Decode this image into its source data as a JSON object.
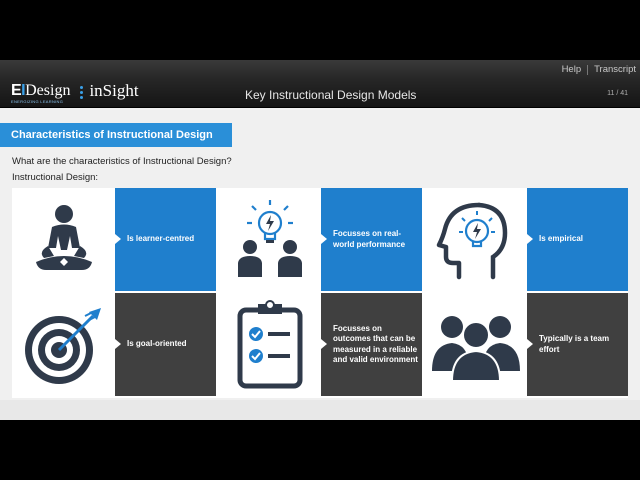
{
  "player": {
    "links": [
      "Help",
      "Transcript"
    ],
    "logo": {
      "ei_e": "E",
      "ei_i": "I",
      "design": "Design",
      "tagline": "ENERGIZING LEARNING",
      "product": "inSight"
    },
    "title": "Key Instructional Design Models",
    "slide_counter": "11 / 41"
  },
  "slide": {
    "banner": "Characteristics of Instructional Design",
    "question": "What are the characteristics of Instructional Design?",
    "intro": "Instructional Design:",
    "cards": [
      {
        "icon": "meditating-person-icon",
        "label": "Is learner-centred",
        "color": "#1f7fcd"
      },
      {
        "icon": "people-lightbulb-icon",
        "label": "Focusses on real-world performance",
        "color": "#1f7fcd"
      },
      {
        "icon": "head-lightbulb-icon",
        "label": "Is empirical",
        "color": "#1f7fcd"
      },
      {
        "icon": "target-arrow-icon",
        "label": "Is goal-oriented",
        "color": "#404040"
      },
      {
        "icon": "checklist-clipboard-icon",
        "label": "Focusses on outcomes that can be measured in a reliable and valid environment",
        "color": "#404040"
      },
      {
        "icon": "team-silhouettes-icon",
        "label": "Typically is a team effort",
        "color": "#404040"
      }
    ]
  }
}
